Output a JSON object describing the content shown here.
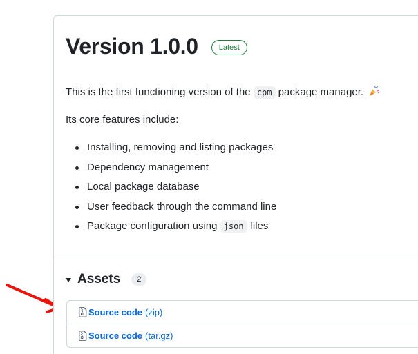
{
  "release": {
    "title": "Version 1.0.0",
    "badge": "Latest"
  },
  "description": {
    "intro_before": "This is the first functioning version of the",
    "intro_code": "cpm",
    "intro_after": "package manager.",
    "intro_emoji": "party-popper-icon",
    "features_intro": "Its core features include:",
    "features": [
      {
        "text": "Installing, removing and listing packages"
      },
      {
        "text": "Dependency management"
      },
      {
        "text": "Local package database"
      },
      {
        "text": "User feedback through the command line"
      },
      {
        "before": "Package configuration using",
        "code": "json",
        "after": "files"
      }
    ]
  },
  "assets": {
    "title": "Assets",
    "count": "2",
    "items": [
      {
        "label": "Source code",
        "ext": "(zip)",
        "icon": "file-zip-icon"
      },
      {
        "label": "Source code",
        "ext": "(tar.gz)",
        "icon": "file-zip-icon"
      }
    ]
  },
  "colors": {
    "link": "#0969da",
    "badge": "#1a7f37",
    "border": "#d0d7de",
    "annotation_arrow": "#e8160c"
  }
}
